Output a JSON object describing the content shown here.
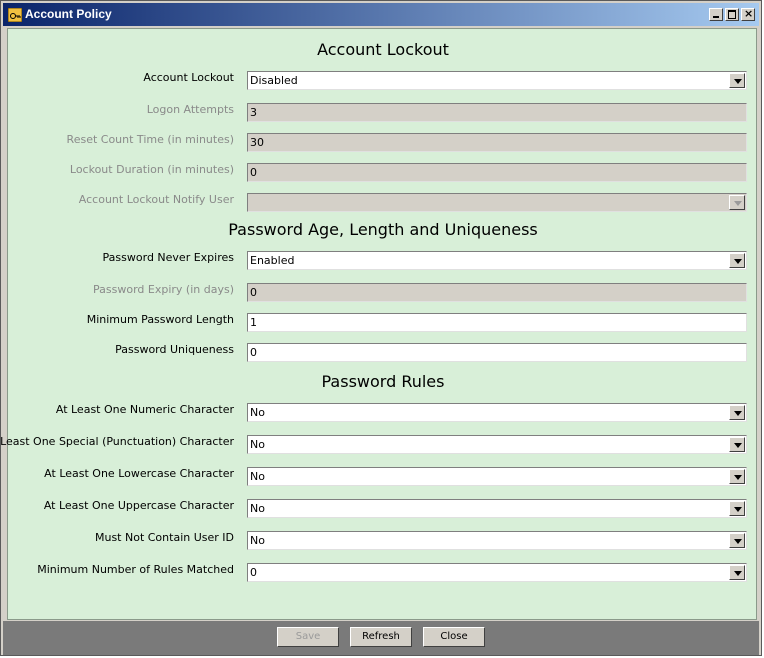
{
  "window": {
    "title": "Account Policy"
  },
  "sections": {
    "lockout": "Account Lockout",
    "password_age": "Password Age, Length and Uniqueness",
    "rules": "Password Rules"
  },
  "fields": {
    "account_lockout": {
      "label": "Account Lockout",
      "value": "Disabled"
    },
    "logon_attempts": {
      "label": "Logon Attempts",
      "value": "3"
    },
    "reset_count_time": {
      "label": "Reset Count Time (in minutes)",
      "value": "30"
    },
    "lockout_duration": {
      "label": "Lockout Duration (in minutes)",
      "value": "0"
    },
    "lockout_notify_user": {
      "label": "Account Lockout Notify User",
      "value": ""
    },
    "password_never_expires": {
      "label": "Password Never Expires",
      "value": "Enabled"
    },
    "password_expiry": {
      "label": "Password Expiry (in days)",
      "value": "0"
    },
    "min_password_length": {
      "label": "Minimum Password Length",
      "value": "1"
    },
    "password_uniqueness": {
      "label": "Password Uniqueness",
      "value": "0"
    },
    "numeric_char": {
      "label": "At Least One Numeric Character",
      "value": "No"
    },
    "special_char": {
      "label": "At Least One Special (Punctuation) Character",
      "value": "No"
    },
    "lowercase_char": {
      "label": "At Least One Lowercase Character",
      "value": "No"
    },
    "uppercase_char": {
      "label": "At Least One Uppercase Character",
      "value": "No"
    },
    "no_user_id": {
      "label": "Must Not Contain User ID",
      "value": "No"
    },
    "min_rules_matched": {
      "label": "Minimum Number of Rules Matched",
      "value": "0"
    }
  },
  "buttons": {
    "save": "Save",
    "refresh": "Refresh",
    "close": "Close"
  },
  "colors": {
    "title_start": "#0a246a",
    "title_end": "#a6caf0",
    "content_bg": "#d8efd8",
    "footer_bg": "#7a7a7a"
  }
}
